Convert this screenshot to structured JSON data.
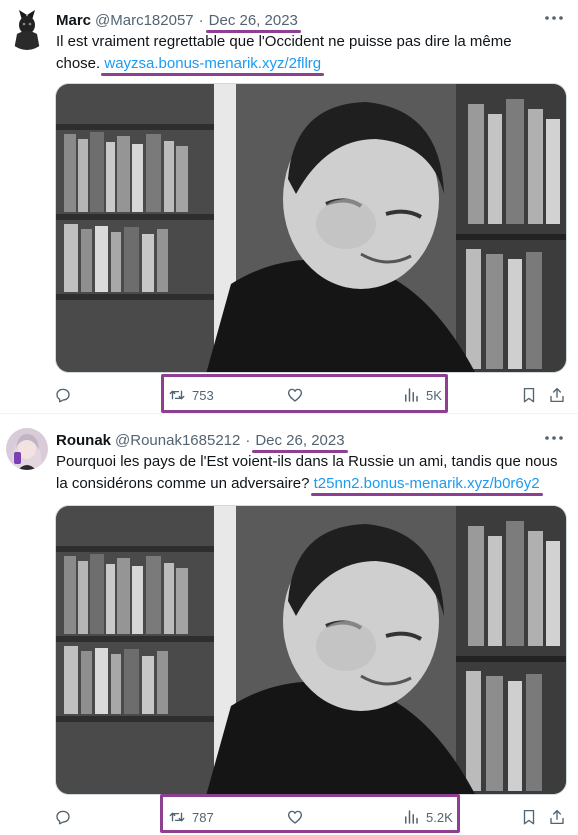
{
  "tweets": [
    {
      "name": "Marc",
      "handle": "@Marc182057",
      "separator": "·",
      "date": "Dec 26, 2023",
      "text_line1": "Il est vraiment regrettable que l'Occident ne puisse pas dire la même",
      "text_line2_prefix": "chose.",
      "link": "wayzsa.bonus-menarik.xyz/2fllrg",
      "retweets": "753",
      "views": "5K"
    },
    {
      "name": "Rounak",
      "handle": "@Rounak1685212",
      "separator": "·",
      "date": "Dec 26, 2023",
      "text_line1": "Pourquoi les pays de l'Est voient-ils dans la Russie un ami, tandis que nous",
      "text_line2_prefix": "la considérons comme un adversaire?",
      "link": "t25nn2.bonus-menarik.xyz/b0r6y2",
      "retweets": "787",
      "views": "5.2K"
    }
  ],
  "colors": {
    "highlight": "#8e3f91",
    "link": "#1d9bf0",
    "secondary_text": "#536471"
  },
  "icons": [
    "more-icon",
    "reply-icon",
    "retweet-icon",
    "like-icon",
    "views-icon",
    "bookmark-icon",
    "share-icon"
  ]
}
